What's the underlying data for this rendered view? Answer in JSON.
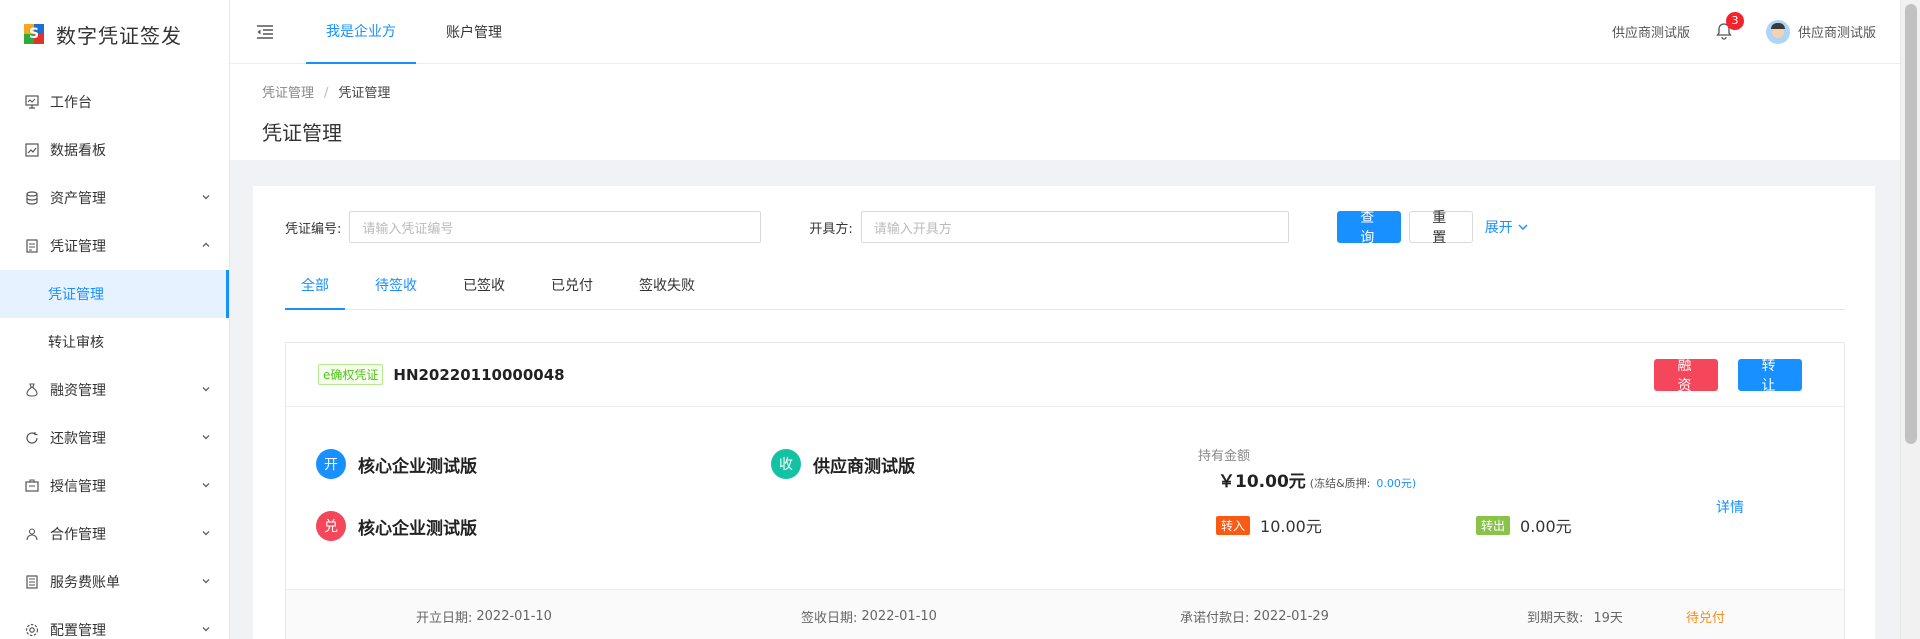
{
  "app": {
    "title": "数字凭证签发"
  },
  "sidebar": {
    "items": [
      {
        "label": "工作台",
        "icon": "monitor-icon"
      },
      {
        "label": "数据看板",
        "icon": "chart-icon"
      },
      {
        "label": "资产管理",
        "icon": "database-icon"
      },
      {
        "label": "凭证管理",
        "icon": "document-icon"
      },
      {
        "label": "融资管理",
        "icon": "money-bag-icon"
      },
      {
        "label": "还款管理",
        "icon": "refresh-icon"
      },
      {
        "label": "授信管理",
        "icon": "credit-icon"
      },
      {
        "label": "合作管理",
        "icon": "partners-icon"
      },
      {
        "label": "服务费账单",
        "icon": "bill-icon"
      },
      {
        "label": "配置管理",
        "icon": "settings-icon"
      }
    ],
    "sub_items": [
      {
        "label": "凭证管理"
      },
      {
        "label": "转让审核"
      }
    ]
  },
  "header": {
    "tabs": [
      {
        "label": "我是企业方"
      },
      {
        "label": "账户管理"
      }
    ],
    "vendor_name": "供应商测试版",
    "notification_count": "3",
    "user_name": "供应商测试版"
  },
  "breadcrumb": {
    "root": "凭证管理",
    "separator": "/",
    "current": "凭证管理"
  },
  "page_title": "凭证管理",
  "filters": {
    "voucher_no_label": "凭证编号:",
    "voucher_no_placeholder": "请输入凭证编号",
    "issuer_label": "开具方:",
    "issuer_placeholder": "请输入开具方",
    "query": "查 询",
    "reset": "重 置",
    "expand": "展开"
  },
  "tabs": [
    {
      "label": "全部"
    },
    {
      "label": "待签收"
    },
    {
      "label": "已签收"
    },
    {
      "label": "已兑付"
    },
    {
      "label": "签收失败"
    }
  ],
  "voucher": {
    "tag": "e确权凭证",
    "number": "HN20220110000048",
    "finance_btn": "融 资",
    "transfer_btn": "转 让",
    "issuer_circle": "开",
    "issuer": "核心企业测试版",
    "receiver_circle": "收",
    "receiver": "供应商测试版",
    "payer_circle": "兑",
    "payer": "核心企业测试版",
    "hold_label": "持有金额",
    "hold_amount": "￥10.00元",
    "frozen_label": "(冻结&质押:",
    "frozen_value": "0.00元)",
    "in_tag": "转入",
    "in_amount": "10.00元",
    "out_tag": "转出",
    "out_amount": "0.00元",
    "detail": "详情",
    "open_date_label": "开立日期:",
    "open_date": "2022-01-10",
    "sign_date_label": "签收日期:",
    "sign_date": "2022-01-10",
    "due_date_label": "承诺付款日:",
    "due_date": "2022-01-29",
    "days_label": "到期天数:",
    "days": "19天",
    "status": "待兑付"
  },
  "colors": {
    "primary": "#1890ff",
    "danger": "#f5475b",
    "issuer_circle": "#1890ff",
    "receiver_circle": "#13c2a3",
    "payer_circle": "#f5475b",
    "in_tag": "#fa5a14",
    "out_tag": "#8bc34a",
    "status": "#fa8c16"
  }
}
